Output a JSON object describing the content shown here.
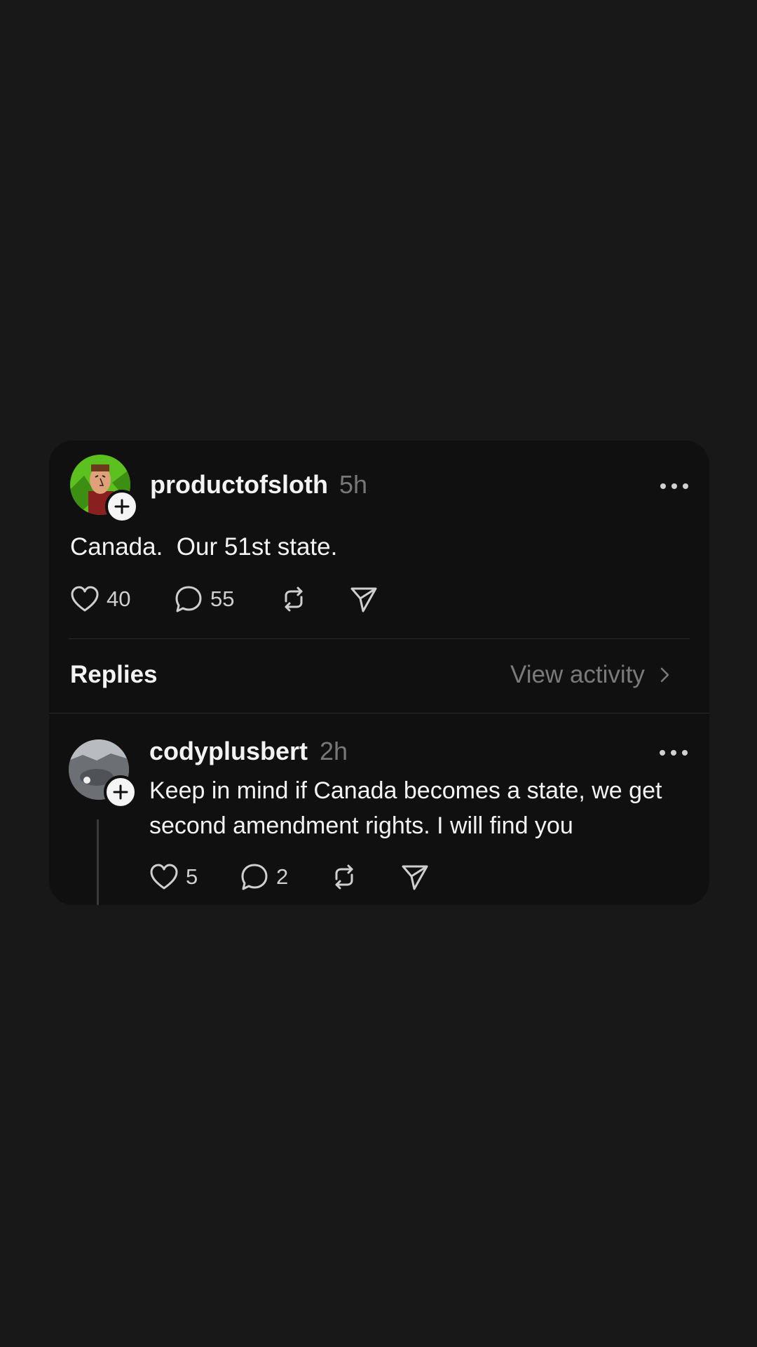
{
  "post": {
    "username": "productofsloth",
    "time": "5h",
    "text": "Canada.  Our 51st state.",
    "likes": "40",
    "comments": "55"
  },
  "replies_section": {
    "label": "Replies",
    "view_activity": "View activity"
  },
  "reply": {
    "username": "codyplusbert",
    "time": "2h",
    "text": "Keep in mind if Canada becomes a state, we get second amendment rights. I will find you",
    "likes": "5",
    "comments": "2"
  },
  "colors": {
    "background": "#181818",
    "card": "#101010",
    "secondary_text": "#777777"
  }
}
